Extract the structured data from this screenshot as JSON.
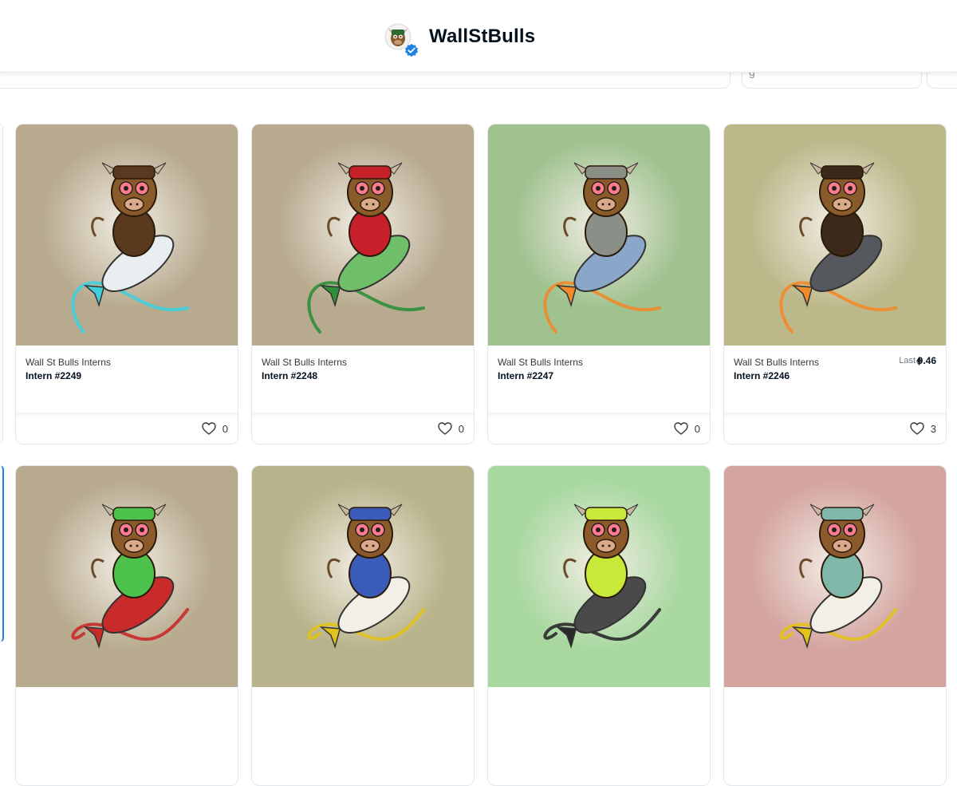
{
  "header": {
    "collection_name": "WallStBulls",
    "verified": true,
    "toolbar_hint": "g"
  },
  "colors": {
    "accent": "#2081e2",
    "border": "#e5e8eb",
    "text": "#04111d"
  },
  "cards": [
    {
      "collection": "Wall St Bulls Interns",
      "token": "Intern #2249",
      "likes": "0",
      "last_label": "",
      "last_price": "",
      "bg": "#b7aa8e",
      "rocket": "#e8edf0",
      "flame": "#3fd0e0",
      "hat": "",
      "hat_color": "#5a3a1f"
    },
    {
      "collection": "Wall St Bulls Interns",
      "token": "Intern #2248",
      "likes": "0",
      "last_label": "",
      "last_price": "",
      "bg": "#b7aa8e",
      "rocket": "#6fbf6a",
      "flame": "#2f8f3a",
      "hat": "",
      "hat_color": "#c8202a"
    },
    {
      "collection": "Wall St Bulls Interns",
      "token": "Intern #2247",
      "likes": "0",
      "last_label": "",
      "last_price": "",
      "bg": "#9fc28f",
      "rocket": "#8aa6c8",
      "flame": "#f08a2a",
      "hat": "",
      "hat_color": "#8a8f88"
    },
    {
      "collection": "Wall St Bulls Interns",
      "token": "Intern #2246",
      "likes": "3",
      "last_label": "Last",
      "last_price": "0.46",
      "bg": "#bdb88a",
      "rocket": "#55585c",
      "flame": "#f08a2a",
      "hat": "",
      "hat_color": "#3b2a1a"
    },
    {
      "collection": "",
      "token": "",
      "likes": "",
      "last_label": "",
      "last_price": "",
      "bg": "#b7aa8e",
      "rocket": "#c92a2a",
      "flame": "#c92a2a",
      "hat": "",
      "hat_color": "#4cc24c"
    },
    {
      "collection": "",
      "token": "",
      "likes": "",
      "last_label": "",
      "last_price": "",
      "bg": "#b8b38a",
      "rocket": "#f2efe6",
      "flame": "#e3c21a",
      "hat": "",
      "hat_color": "#3b5bb8"
    },
    {
      "collection": "",
      "token": "",
      "likes": "",
      "last_label": "",
      "last_price": "",
      "bg": "#a8d8a0",
      "rocket": "#4a4a4a",
      "flame": "#2a2a2a",
      "hat": "",
      "hat_color": "#c8e83a"
    },
    {
      "collection": "",
      "token": "",
      "likes": "",
      "last_label": "",
      "last_price": "",
      "bg": "#d4a4a0",
      "rocket": "#f2efe6",
      "flame": "#e3c21a",
      "hat": "",
      "hat_color": "#7fb8a8"
    }
  ]
}
